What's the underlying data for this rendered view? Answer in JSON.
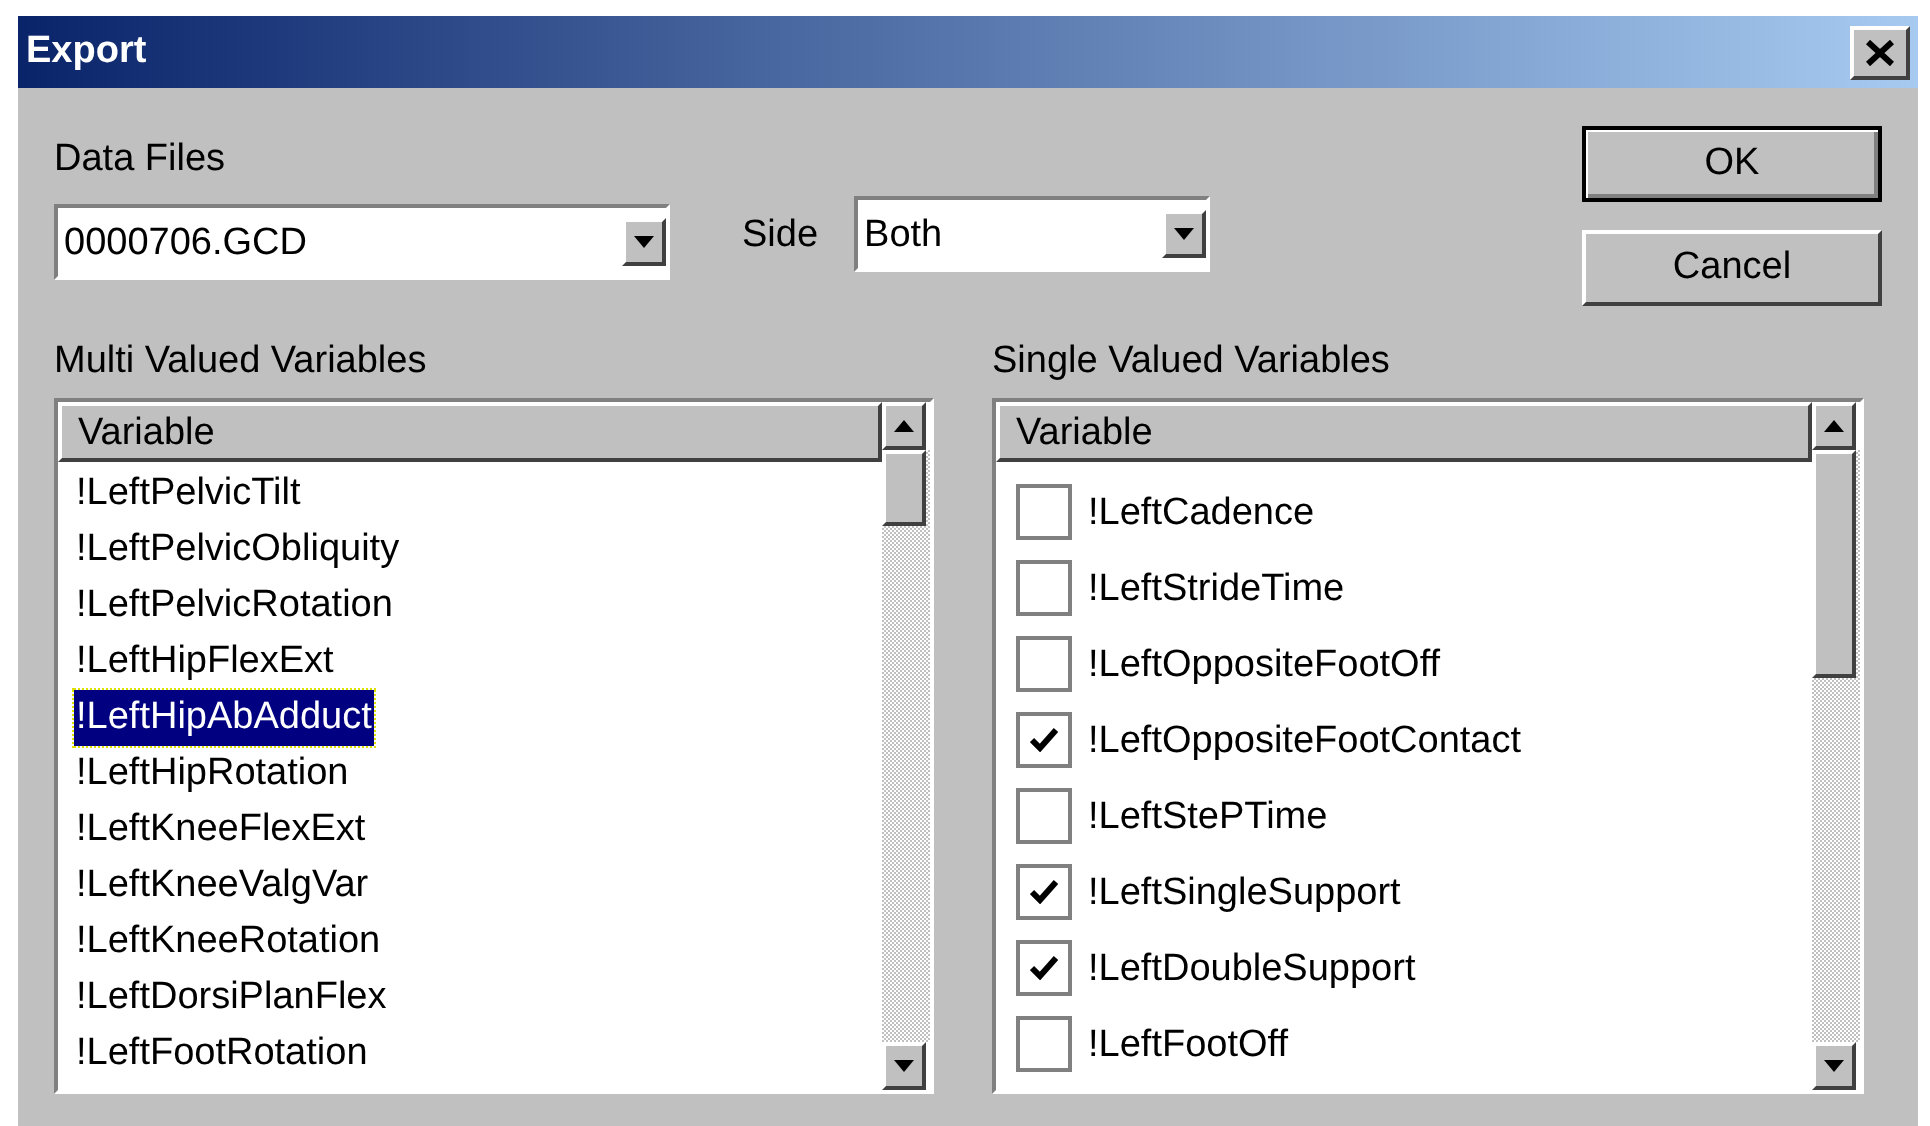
{
  "window": {
    "title": "Export"
  },
  "data_files": {
    "label": "Data Files",
    "value": "0000706.GCD"
  },
  "side": {
    "label": "Side",
    "value": "Both"
  },
  "buttons": [
    "OK",
    "Cancel"
  ],
  "multi_valued": {
    "label": "Multi Valued Variables",
    "column": "Variable",
    "items": [
      {
        "label": "!LeftPelvicTilt",
        "selected": false
      },
      {
        "label": "!LeftPelvicObliquity",
        "selected": false
      },
      {
        "label": "!LeftPelvicRotation",
        "selected": false
      },
      {
        "label": "!LeftHipFlexExt",
        "selected": false
      },
      {
        "label": "!LeftHipAbAdduct",
        "selected": true
      },
      {
        "label": "!LeftHipRotation",
        "selected": false
      },
      {
        "label": "!LeftKneeFlexExt",
        "selected": false
      },
      {
        "label": "!LeftKneeValgVar",
        "selected": false
      },
      {
        "label": "!LeftKneeRotation",
        "selected": false
      },
      {
        "label": "!LeftDorsiPlanFlex",
        "selected": false
      },
      {
        "label": "!LeftFootRotation",
        "selected": false
      }
    ]
  },
  "single_valued": {
    "label": "Single Valued Variables",
    "column": "Variable",
    "items": [
      {
        "label": "!LeftCadence",
        "checked": false
      },
      {
        "label": "!LeftStrideTime",
        "checked": false
      },
      {
        "label": "!LeftOppositeFootOff",
        "checked": false
      },
      {
        "label": "!LeftOppositeFootContact",
        "checked": true
      },
      {
        "label": "!LeftStePTime",
        "checked": false
      },
      {
        "label": "!LeftSingleSupport",
        "checked": true
      },
      {
        "label": "!LeftDoubleSupport",
        "checked": true
      },
      {
        "label": "!LeftFootOff",
        "checked": false
      }
    ]
  }
}
